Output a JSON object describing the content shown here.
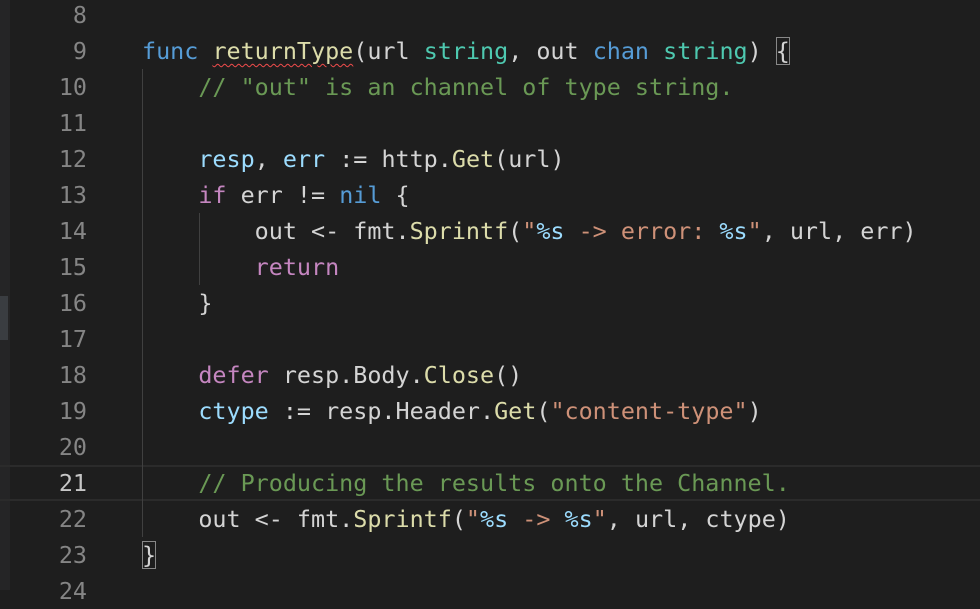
{
  "editor": {
    "lines": [
      {
        "num": "8",
        "tokens": []
      },
      {
        "num": "9",
        "tokens": [
          {
            "t": "func",
            "c": "kw"
          },
          {
            "t": " "
          },
          {
            "t": "returnType",
            "c": "fn squiggle"
          },
          {
            "t": "(url "
          },
          {
            "t": "string",
            "c": "type"
          },
          {
            "t": ", out "
          },
          {
            "t": "chan",
            "c": "kw"
          },
          {
            "t": " "
          },
          {
            "t": "string",
            "c": "type"
          },
          {
            "t": ") "
          },
          {
            "t": "{",
            "c": "bracket-hl"
          }
        ]
      },
      {
        "num": "10",
        "tokens": [
          {
            "t": "    "
          },
          {
            "t": "// \"out\" is an channel of type string.",
            "c": "com"
          }
        ]
      },
      {
        "num": "11",
        "tokens": []
      },
      {
        "num": "12",
        "tokens": [
          {
            "t": "    "
          },
          {
            "t": "resp",
            "c": "var"
          },
          {
            "t": ", "
          },
          {
            "t": "err",
            "c": "var"
          },
          {
            "t": " := http."
          },
          {
            "t": "Get",
            "c": "fn"
          },
          {
            "t": "(url)"
          }
        ]
      },
      {
        "num": "13",
        "tokens": [
          {
            "t": "    "
          },
          {
            "t": "if",
            "c": "ctrl"
          },
          {
            "t": " err != "
          },
          {
            "t": "nil",
            "c": "kw"
          },
          {
            "t": " {"
          }
        ]
      },
      {
        "num": "14",
        "tokens": [
          {
            "t": "        out <- fmt."
          },
          {
            "t": "Sprintf",
            "c": "fn"
          },
          {
            "t": "("
          },
          {
            "t": "\"",
            "c": "str"
          },
          {
            "t": "%s",
            "c": "fmt"
          },
          {
            "t": " -> error: ",
            "c": "str"
          },
          {
            "t": "%s",
            "c": "fmt"
          },
          {
            "t": "\"",
            "c": "str"
          },
          {
            "t": ", url, err)"
          }
        ]
      },
      {
        "num": "15",
        "tokens": [
          {
            "t": "        "
          },
          {
            "t": "return",
            "c": "ctrl"
          }
        ]
      },
      {
        "num": "16",
        "tokens": [
          {
            "t": "    }"
          }
        ]
      },
      {
        "num": "17",
        "tokens": []
      },
      {
        "num": "18",
        "tokens": [
          {
            "t": "    "
          },
          {
            "t": "defer",
            "c": "ctrl"
          },
          {
            "t": " resp.Body."
          },
          {
            "t": "Close",
            "c": "fn"
          },
          {
            "t": "()"
          }
        ]
      },
      {
        "num": "19",
        "tokens": [
          {
            "t": "    "
          },
          {
            "t": "ctype",
            "c": "var"
          },
          {
            "t": " := resp.Header."
          },
          {
            "t": "Get",
            "c": "fn"
          },
          {
            "t": "("
          },
          {
            "t": "\"content-type\"",
            "c": "str"
          },
          {
            "t": ")"
          }
        ]
      },
      {
        "num": "20",
        "tokens": []
      },
      {
        "num": "21",
        "current": true,
        "tokens": [
          {
            "t": "    "
          },
          {
            "t": "// Producing the results onto the Channel.",
            "c": "com"
          }
        ]
      },
      {
        "num": "22",
        "tokens": [
          {
            "t": "    out <- fmt."
          },
          {
            "t": "Sprintf",
            "c": "fn"
          },
          {
            "t": "("
          },
          {
            "t": "\"",
            "c": "str"
          },
          {
            "t": "%s",
            "c": "fmt"
          },
          {
            "t": " -> ",
            "c": "str"
          },
          {
            "t": "%s",
            "c": "fmt"
          },
          {
            "t": "\"",
            "c": "str"
          },
          {
            "t": ", url, ctype)"
          }
        ]
      },
      {
        "num": "23",
        "tokens": [
          {
            "t": "}",
            "c": "bracket-hl"
          }
        ]
      },
      {
        "num": "24",
        "tokens": []
      }
    ]
  }
}
